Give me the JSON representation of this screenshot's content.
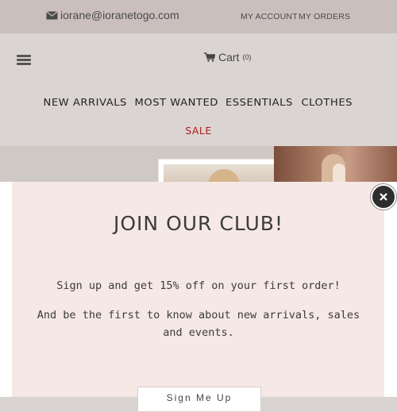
{
  "topbar": {
    "email": "iorane@ioranetogo.com",
    "my_account": "MY ACCOUNT",
    "my_orders": "MY ORDERS"
  },
  "header": {
    "cart_label": "Cart",
    "cart_count": "(0)"
  },
  "nav": {
    "items": [
      {
        "label": "NEW ARRIVALS"
      },
      {
        "label": "MOST WANTED"
      },
      {
        "label": "ESSENTIALS"
      },
      {
        "label": "CLOTHES"
      }
    ],
    "sale": "SALE",
    "sale_color": "#b01d1d"
  },
  "modal": {
    "title": "JOIN OUR CLUB!",
    "line1": "Sign up and get 15% off on your first order!",
    "line2": "And be the first to know about new arrivals, sales and events.",
    "button_label": "Sign Me Up"
  },
  "colors": {
    "topbar_bg": "#cbbfbd",
    "modal_bg": "#f5e8e5"
  },
  "icons": [
    "envelope-icon",
    "hamburger-icon",
    "cart-icon",
    "close-icon"
  ]
}
